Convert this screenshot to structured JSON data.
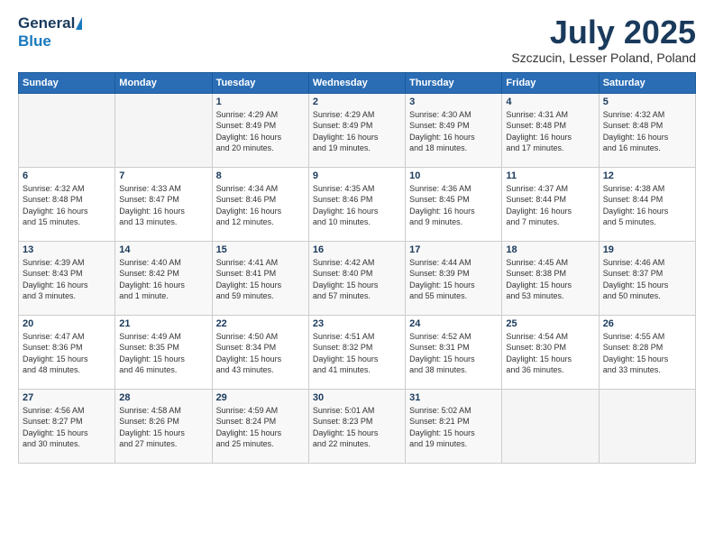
{
  "header": {
    "logo_general": "General",
    "logo_blue": "Blue",
    "month_title": "July 2025",
    "location": "Szczucin, Lesser Poland, Poland"
  },
  "days_of_week": [
    "Sunday",
    "Monday",
    "Tuesday",
    "Wednesday",
    "Thursday",
    "Friday",
    "Saturday"
  ],
  "weeks": [
    {
      "cells": [
        {
          "day": "",
          "info": ""
        },
        {
          "day": "",
          "info": ""
        },
        {
          "day": "1",
          "info": "Sunrise: 4:29 AM\nSunset: 8:49 PM\nDaylight: 16 hours\nand 20 minutes."
        },
        {
          "day": "2",
          "info": "Sunrise: 4:29 AM\nSunset: 8:49 PM\nDaylight: 16 hours\nand 19 minutes."
        },
        {
          "day": "3",
          "info": "Sunrise: 4:30 AM\nSunset: 8:49 PM\nDaylight: 16 hours\nand 18 minutes."
        },
        {
          "day": "4",
          "info": "Sunrise: 4:31 AM\nSunset: 8:48 PM\nDaylight: 16 hours\nand 17 minutes."
        },
        {
          "day": "5",
          "info": "Sunrise: 4:32 AM\nSunset: 8:48 PM\nDaylight: 16 hours\nand 16 minutes."
        }
      ]
    },
    {
      "cells": [
        {
          "day": "6",
          "info": "Sunrise: 4:32 AM\nSunset: 8:48 PM\nDaylight: 16 hours\nand 15 minutes."
        },
        {
          "day": "7",
          "info": "Sunrise: 4:33 AM\nSunset: 8:47 PM\nDaylight: 16 hours\nand 13 minutes."
        },
        {
          "day": "8",
          "info": "Sunrise: 4:34 AM\nSunset: 8:46 PM\nDaylight: 16 hours\nand 12 minutes."
        },
        {
          "day": "9",
          "info": "Sunrise: 4:35 AM\nSunset: 8:46 PM\nDaylight: 16 hours\nand 10 minutes."
        },
        {
          "day": "10",
          "info": "Sunrise: 4:36 AM\nSunset: 8:45 PM\nDaylight: 16 hours\nand 9 minutes."
        },
        {
          "day": "11",
          "info": "Sunrise: 4:37 AM\nSunset: 8:44 PM\nDaylight: 16 hours\nand 7 minutes."
        },
        {
          "day": "12",
          "info": "Sunrise: 4:38 AM\nSunset: 8:44 PM\nDaylight: 16 hours\nand 5 minutes."
        }
      ]
    },
    {
      "cells": [
        {
          "day": "13",
          "info": "Sunrise: 4:39 AM\nSunset: 8:43 PM\nDaylight: 16 hours\nand 3 minutes."
        },
        {
          "day": "14",
          "info": "Sunrise: 4:40 AM\nSunset: 8:42 PM\nDaylight: 16 hours\nand 1 minute."
        },
        {
          "day": "15",
          "info": "Sunrise: 4:41 AM\nSunset: 8:41 PM\nDaylight: 15 hours\nand 59 minutes."
        },
        {
          "day": "16",
          "info": "Sunrise: 4:42 AM\nSunset: 8:40 PM\nDaylight: 15 hours\nand 57 minutes."
        },
        {
          "day": "17",
          "info": "Sunrise: 4:44 AM\nSunset: 8:39 PM\nDaylight: 15 hours\nand 55 minutes."
        },
        {
          "day": "18",
          "info": "Sunrise: 4:45 AM\nSunset: 8:38 PM\nDaylight: 15 hours\nand 53 minutes."
        },
        {
          "day": "19",
          "info": "Sunrise: 4:46 AM\nSunset: 8:37 PM\nDaylight: 15 hours\nand 50 minutes."
        }
      ]
    },
    {
      "cells": [
        {
          "day": "20",
          "info": "Sunrise: 4:47 AM\nSunset: 8:36 PM\nDaylight: 15 hours\nand 48 minutes."
        },
        {
          "day": "21",
          "info": "Sunrise: 4:49 AM\nSunset: 8:35 PM\nDaylight: 15 hours\nand 46 minutes."
        },
        {
          "day": "22",
          "info": "Sunrise: 4:50 AM\nSunset: 8:34 PM\nDaylight: 15 hours\nand 43 minutes."
        },
        {
          "day": "23",
          "info": "Sunrise: 4:51 AM\nSunset: 8:32 PM\nDaylight: 15 hours\nand 41 minutes."
        },
        {
          "day": "24",
          "info": "Sunrise: 4:52 AM\nSunset: 8:31 PM\nDaylight: 15 hours\nand 38 minutes."
        },
        {
          "day": "25",
          "info": "Sunrise: 4:54 AM\nSunset: 8:30 PM\nDaylight: 15 hours\nand 36 minutes."
        },
        {
          "day": "26",
          "info": "Sunrise: 4:55 AM\nSunset: 8:28 PM\nDaylight: 15 hours\nand 33 minutes."
        }
      ]
    },
    {
      "cells": [
        {
          "day": "27",
          "info": "Sunrise: 4:56 AM\nSunset: 8:27 PM\nDaylight: 15 hours\nand 30 minutes."
        },
        {
          "day": "28",
          "info": "Sunrise: 4:58 AM\nSunset: 8:26 PM\nDaylight: 15 hours\nand 27 minutes."
        },
        {
          "day": "29",
          "info": "Sunrise: 4:59 AM\nSunset: 8:24 PM\nDaylight: 15 hours\nand 25 minutes."
        },
        {
          "day": "30",
          "info": "Sunrise: 5:01 AM\nSunset: 8:23 PM\nDaylight: 15 hours\nand 22 minutes."
        },
        {
          "day": "31",
          "info": "Sunrise: 5:02 AM\nSunset: 8:21 PM\nDaylight: 15 hours\nand 19 minutes."
        },
        {
          "day": "",
          "info": ""
        },
        {
          "day": "",
          "info": ""
        }
      ]
    }
  ],
  "col_classes": [
    "col-sun",
    "col-mon",
    "col-tue",
    "col-wed",
    "col-thu",
    "col-fri",
    "col-sat"
  ]
}
